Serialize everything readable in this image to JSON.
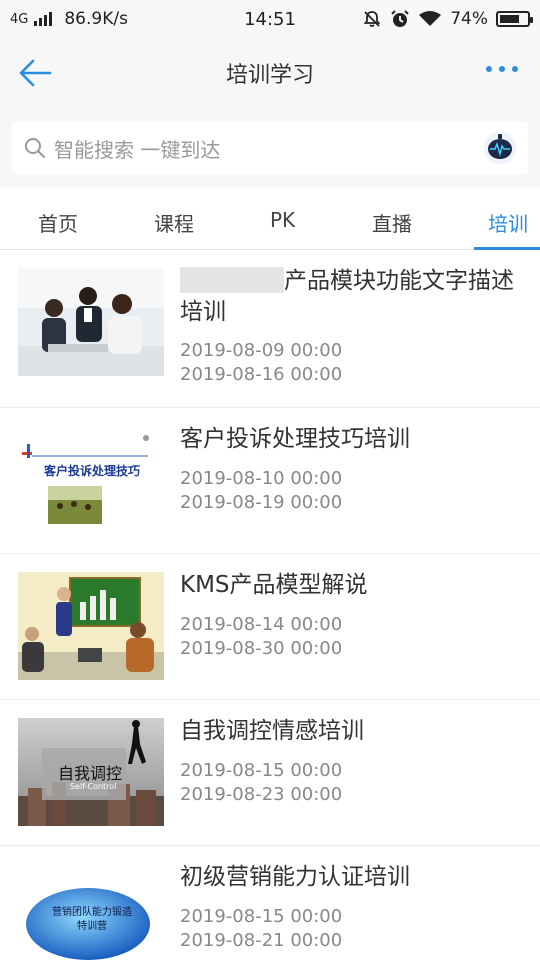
{
  "status_bar": {
    "network": "4G",
    "speed": "86.9K/s",
    "time": "14:51",
    "battery": "74%",
    "battery_level": 0.74
  },
  "header": {
    "title": "培训学习"
  },
  "search": {
    "placeholder": "智能搜索 一键到达"
  },
  "tabs": [
    {
      "label": "首页",
      "active": false
    },
    {
      "label": "课程",
      "active": false
    },
    {
      "label": "PK",
      "active": false
    },
    {
      "label": "直播",
      "active": false
    },
    {
      "label": "培训",
      "active": true
    }
  ],
  "colors": {
    "accent": "#2a8de0"
  },
  "trainings": [
    {
      "title": "产品模块功能文字描述培训",
      "start": "2019-08-09 00:00",
      "end": "2019-08-16 00:00"
    },
    {
      "title": "客户投诉处理技巧培训",
      "start": "2019-08-10 00:00",
      "end": "2019-08-19 00:00",
      "thumb_text": "客户投诉处理技巧"
    },
    {
      "title": "KMS产品模型解说",
      "start": "2019-08-14 00:00",
      "end": "2019-08-30 00:00"
    },
    {
      "title": "自我调控情感培训",
      "start": "2019-08-15 00:00",
      "end": "2019-08-23 00:00",
      "thumb_text": "自我调控",
      "thumb_subtext": "Self-Control"
    },
    {
      "title": "初级营销能力认证培训",
      "start": "2019-08-15 00:00",
      "end": "2019-08-21 00:00",
      "thumb_text_line1": "营销团队能力锻造",
      "thumb_text_line2": "特训营"
    }
  ]
}
